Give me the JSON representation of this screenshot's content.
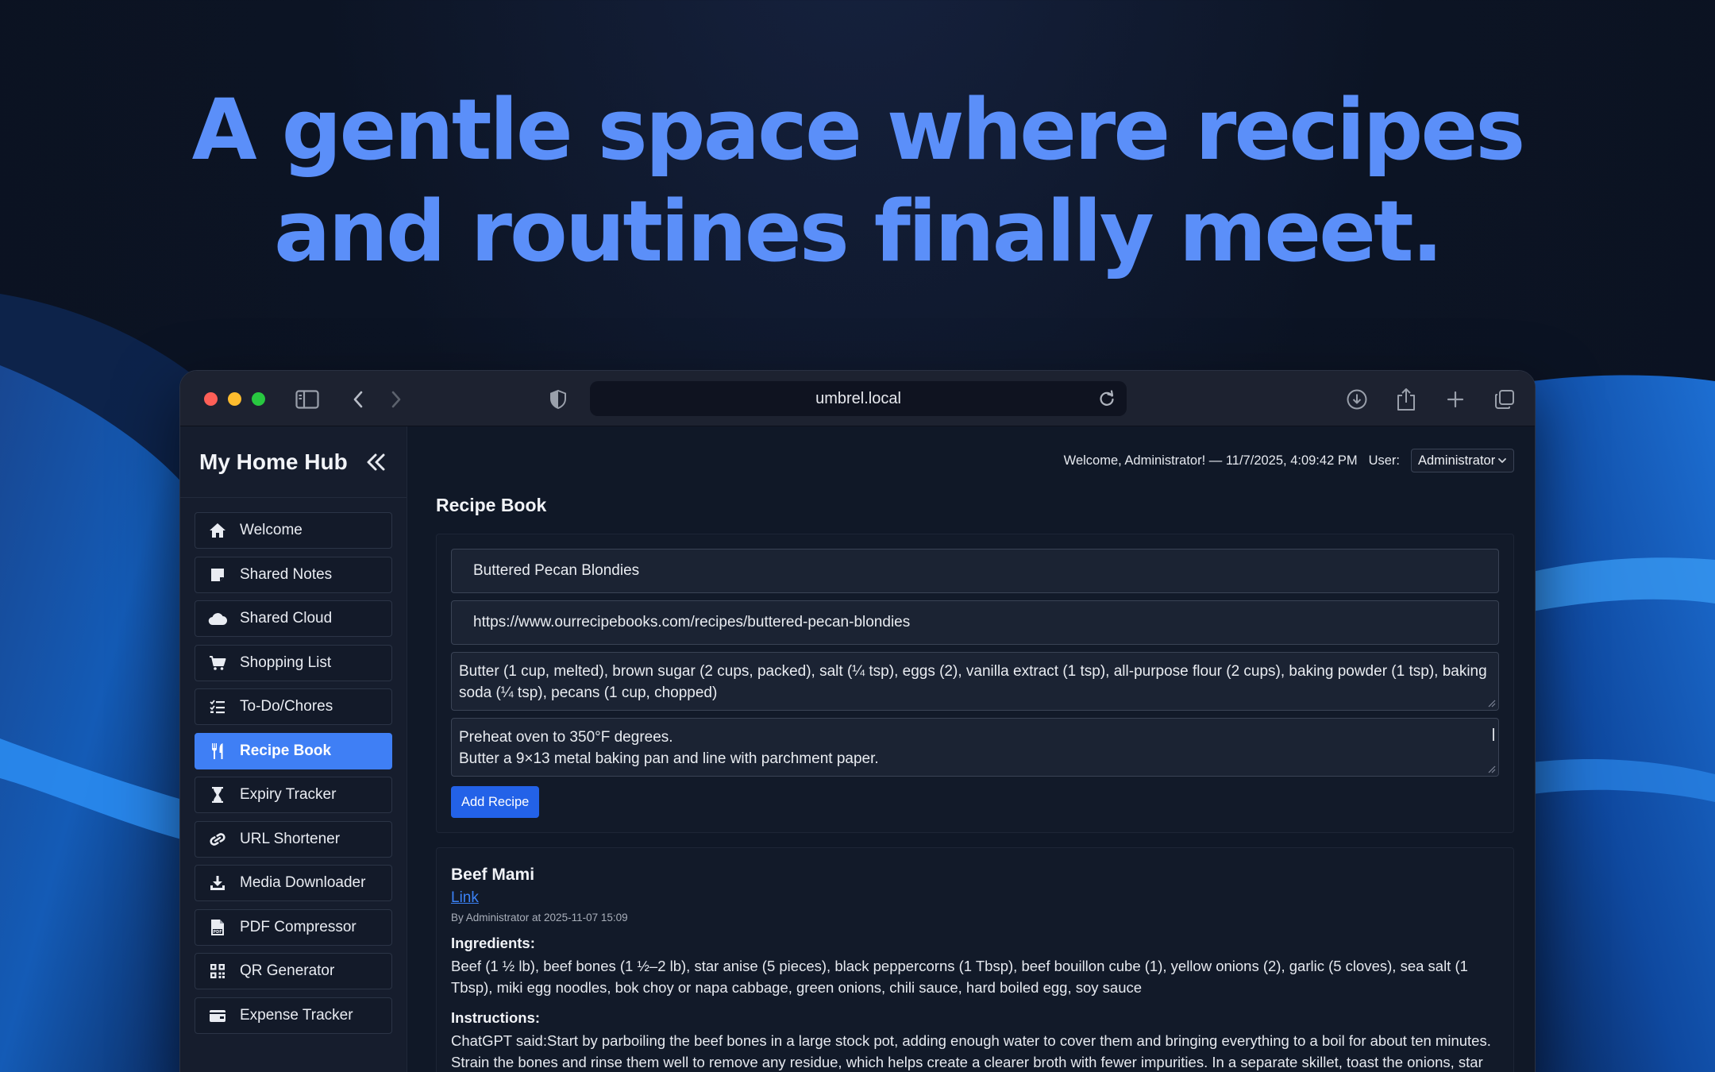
{
  "hero": {
    "line1": "A gentle space where recipes",
    "line2": "and routines finally meet."
  },
  "browser": {
    "url": "umbrel.local"
  },
  "sidebar": {
    "brand": "My Home Hub",
    "items": [
      {
        "label": "Welcome",
        "icon": "home-icon"
      },
      {
        "label": "Shared Notes",
        "icon": "sticky-note-icon"
      },
      {
        "label": "Shared Cloud",
        "icon": "cloud-icon"
      },
      {
        "label": "Shopping List",
        "icon": "cart-icon"
      },
      {
        "label": "To-Do/Chores",
        "icon": "checklist-icon"
      },
      {
        "label": "Recipe Book",
        "icon": "utensils-icon",
        "active": true
      },
      {
        "label": "Expiry Tracker",
        "icon": "hourglass-icon"
      },
      {
        "label": "URL Shortener",
        "icon": "link-icon"
      },
      {
        "label": "Media Downloader",
        "icon": "download-icon"
      },
      {
        "label": "PDF Compressor",
        "icon": "pdf-file-icon"
      },
      {
        "label": "QR Generator",
        "icon": "qr-code-icon"
      },
      {
        "label": "Expense Tracker",
        "icon": "wallet-icon"
      }
    ]
  },
  "header": {
    "welcome": "Welcome, Administrator! — 11/7/2025, 4:09:42 PM",
    "user_label": "User:",
    "user_selected": "Administrator"
  },
  "page": {
    "title": "Recipe Book"
  },
  "form": {
    "name_value": "Buttered Pecan Blondies",
    "url_value": "https://www.ourrecipebooks.com/recipes/buttered-pecan-blondies",
    "ingredients_value": "Butter (1 cup, melted), brown sugar (2 cups, packed), salt (¼ tsp), eggs (2), vanilla extract (1 tsp), all-purpose flour (2 cups), baking powder (1 tsp), baking soda (¼ tsp), pecans (1 cup, chopped)",
    "instructions_line1": "Preheat oven to 350°F degrees.",
    "instructions_line2": "Butter a 9×13 metal baking pan and line with parchment paper.",
    "submit_label": "Add Recipe"
  },
  "recipe": {
    "title": "Beef Mami",
    "link_label": "Link",
    "meta": "By Administrator at 2025-11-07 15:09",
    "ingredients_label": "Ingredients:",
    "ingredients": "Beef (1 ½ lb), beef bones (1 ½–2 lb), star anise (5 pieces), black peppercorns (1 Tbsp), beef bouillon cube (1), yellow onions (2), garlic (5 cloves), sea salt (1 Tbsp), miki egg noodles, bok choy or napa cabbage, green onions, chili sauce, hard boiled egg, soy sauce",
    "instructions_label": "Instructions:",
    "instructions": "ChatGPT said:Start by parboiling the beef bones in a large stock pot, adding enough water to cover them and bringing everything to a boil for about ten minutes. Strain the bones and rinse them well to remove any residue, which helps create a clearer broth with fewer impurities. In a separate skillet, toast the onions, star anise, peppercorns, and garlic until they are slightly charred. Add the beef bones, beef, aromatics, salt, and bouillon to a large pot, then pour in"
  },
  "colors": {
    "accent": "#3f7ff5",
    "hero_text": "#5b8ff9",
    "button": "#2362e8"
  }
}
